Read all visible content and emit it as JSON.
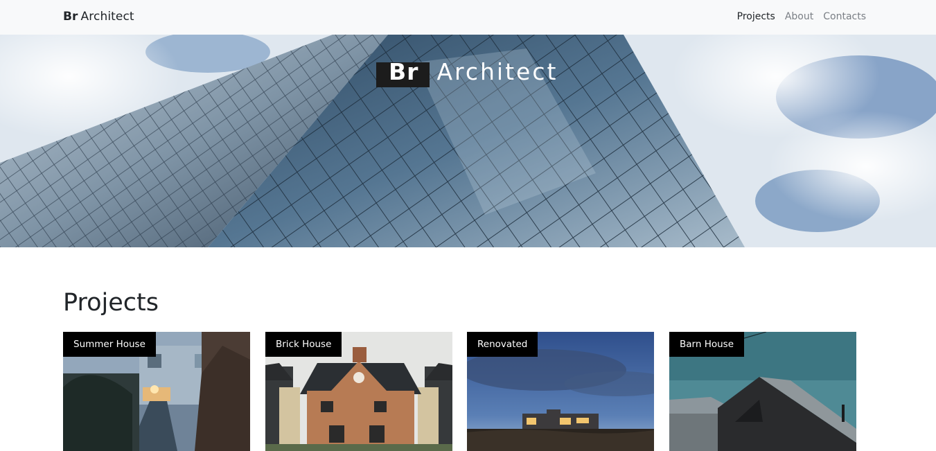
{
  "navbar": {
    "brand_bold": "Br",
    "brand_rest": "Architect",
    "links": [
      {
        "label": "Projects",
        "active": true
      },
      {
        "label": "About",
        "active": false
      },
      {
        "label": "Contacts",
        "active": false
      }
    ]
  },
  "hero": {
    "title_bold": "Br",
    "title_rest": "Architect"
  },
  "projects": {
    "heading": "Projects",
    "cards": [
      {
        "label": "Summer House"
      },
      {
        "label": "Brick House"
      },
      {
        "label": "Renovated"
      },
      {
        "label": "Barn House"
      }
    ]
  },
  "colors": {
    "navbar_bg": "#f8f9fa",
    "label_bg": "#000000",
    "text": "#212529",
    "link_muted": "#7a7f85"
  }
}
